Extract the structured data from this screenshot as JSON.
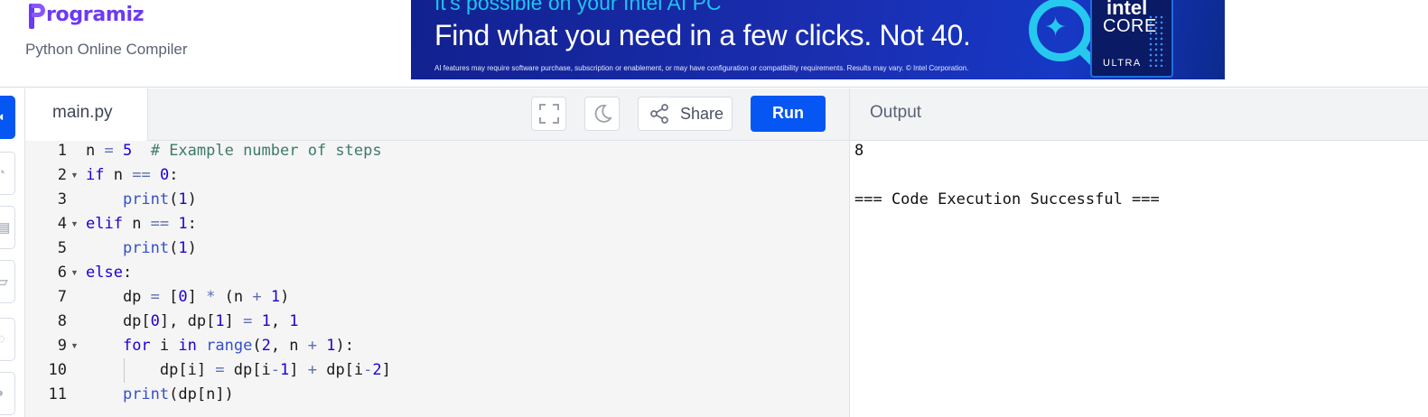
{
  "header": {
    "logo_text": "rogramiz",
    "subtitle": "Python Online Compiler"
  },
  "ad": {
    "line_top": "It's possible on your Intel AI PC",
    "headline": "Find what you need in a few clicks. Not 40.",
    "fineprint": "AI features may require software purchase, subscription or enablement, or may have configuration or compatibility requirements. Results may vary. © Intel Corporation.",
    "chip_brand": "intel",
    "chip_line": "CORE",
    "chip_tier": "ULTRA",
    "accent_color": "#26c8ef"
  },
  "toolbar": {
    "file_tab": "main.py",
    "share_label": "Share",
    "run_label": "Run",
    "fullscreen_icon": "fullscreen-icon",
    "theme_icon": "moon-icon",
    "share_icon": "share-icon"
  },
  "editor": {
    "line_numbers": [
      "1",
      "2",
      "3",
      "4",
      "5",
      "6",
      "7",
      "8",
      "9",
      "10",
      "11"
    ],
    "foldable_lines": [
      2,
      4,
      6,
      9
    ]
  },
  "output": {
    "title": "Output",
    "lines": [
      "8",
      "",
      "=== Code Execution Successful ==="
    ]
  },
  "colors": {
    "brand": "#6b3af2",
    "run_button": "#0556f3"
  }
}
